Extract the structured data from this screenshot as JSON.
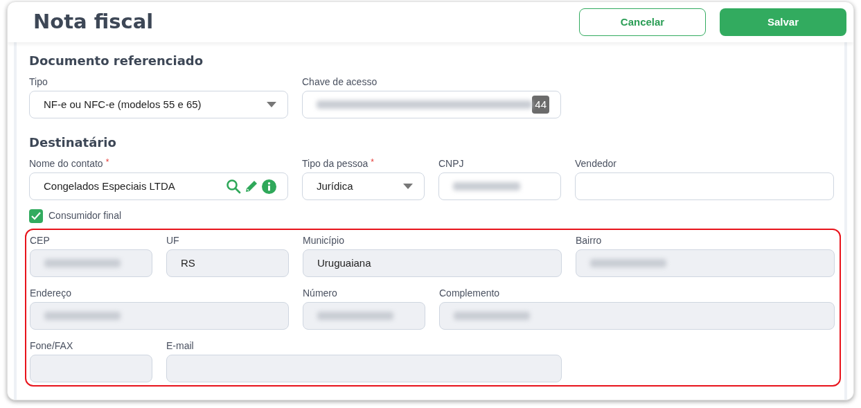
{
  "header": {
    "title": "Nota fiscal",
    "buttons": [
      {
        "label": "Cancelar",
        "kind": "outline"
      },
      {
        "label": "Salvar",
        "kind": "primary"
      }
    ]
  },
  "sections": [
    {
      "title": "Documento referenciado",
      "fields": [
        {
          "label": "Tipo",
          "kind": "select",
          "value": "NF-e ou NFC-e (modelos 55 e 65)",
          "redacted": false
        },
        {
          "label": "Chave de acesso",
          "kind": "counter",
          "redacted": true,
          "counter": "44"
        }
      ]
    },
    {
      "title": "Destinatário",
      "fields": [
        {
          "label": "Nome do contato",
          "required_mark": "*",
          "kind": "contact",
          "value": "Congelados Especiais LTDA",
          "redacted": false
        },
        {
          "label": "Tipo da pessoa",
          "required_mark": "*",
          "kind": "select",
          "value": "Jurídica",
          "redacted": false
        },
        {
          "label": "CNPJ",
          "kind": "text",
          "redacted": true
        },
        {
          "label": "Vendedor",
          "kind": "text",
          "redacted": false
        }
      ],
      "checkbox": {
        "label": "Consumidor final",
        "checked": true
      }
    }
  ],
  "address": {
    "highlighted": true,
    "disabled": true,
    "fields": [
      {
        "label": "CEP",
        "redacted": true
      },
      {
        "label": "UF",
        "value": "RS",
        "redacted": false
      },
      {
        "label": "Município",
        "value": "Uruguaiana",
        "redacted": false
      },
      {
        "label": "Bairro",
        "redacted": true
      },
      {
        "label": "Endereço",
        "redacted": true
      },
      {
        "label": "Número",
        "redacted": true
      },
      {
        "label": "Complemento",
        "redacted": true
      },
      {
        "label": "Fone/FAX",
        "redacted": false
      },
      {
        "label": "E-mail",
        "redacted": false
      }
    ]
  }
}
